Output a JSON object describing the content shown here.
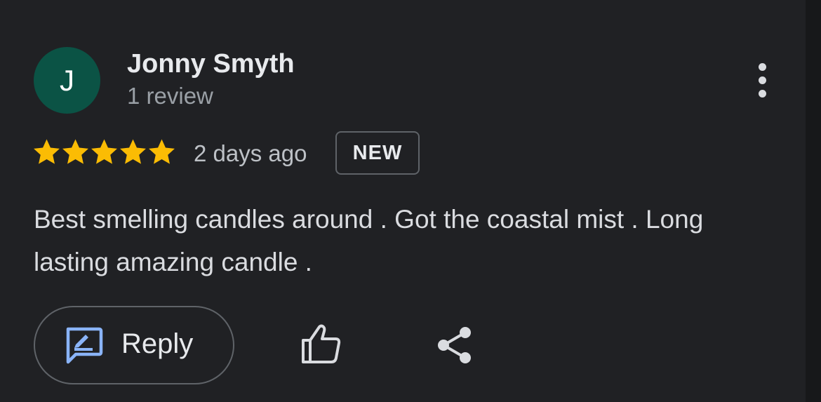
{
  "review": {
    "avatar_initial": "J",
    "author_name": "Jonny Smyth",
    "review_count": "1 review",
    "rating": 5,
    "rating_max": 5,
    "time_ago": "2 days ago",
    "badge": "NEW",
    "text": "Best smelling candles around . Got the coastal mist . Long lasting amazing candle ."
  },
  "actions": {
    "reply_label": "Reply",
    "reply_icon": "reply-icon",
    "like_icon": "thumbs-up-icon",
    "share_icon": "share-icon",
    "more_icon": "more-vertical-icon"
  },
  "colors": {
    "background": "#202124",
    "avatar": "#0b5345",
    "star": "#fbbc04",
    "reply_icon": "#8ab4f8",
    "text_primary": "#e8eaed",
    "text_secondary": "#9aa0a6"
  }
}
